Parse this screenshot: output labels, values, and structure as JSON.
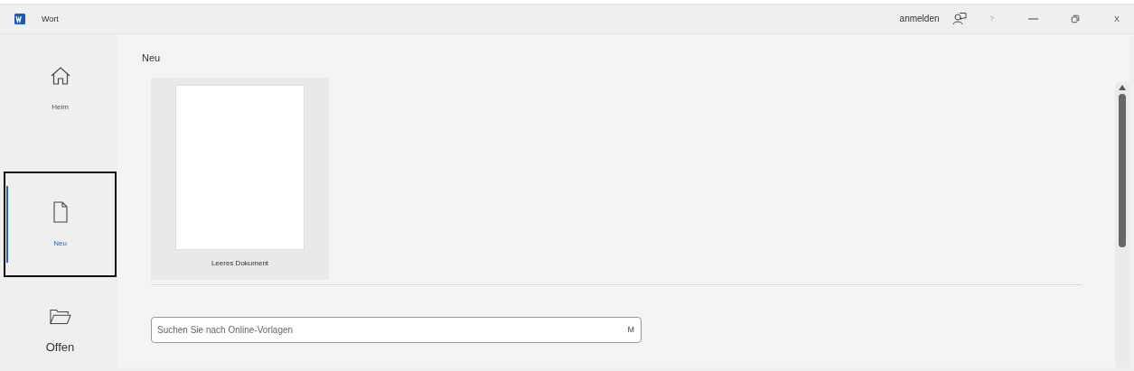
{
  "window": {
    "title": "Wort",
    "sign_in": "anmelden",
    "help": "?",
    "close": "X"
  },
  "nav": [
    {
      "label": "Heim",
      "kind": "home",
      "selected": false
    },
    {
      "label": "Neu",
      "kind": "new",
      "selected": true
    },
    {
      "label": "Offen",
      "kind": "open",
      "selected": false
    }
  ],
  "main": {
    "heading": "Neu",
    "templates": [
      {
        "label": "Leeres Dokument"
      }
    ],
    "search": {
      "placeholder": "Suchen Sie nach Online-Vorlagen",
      "key": "M"
    }
  }
}
